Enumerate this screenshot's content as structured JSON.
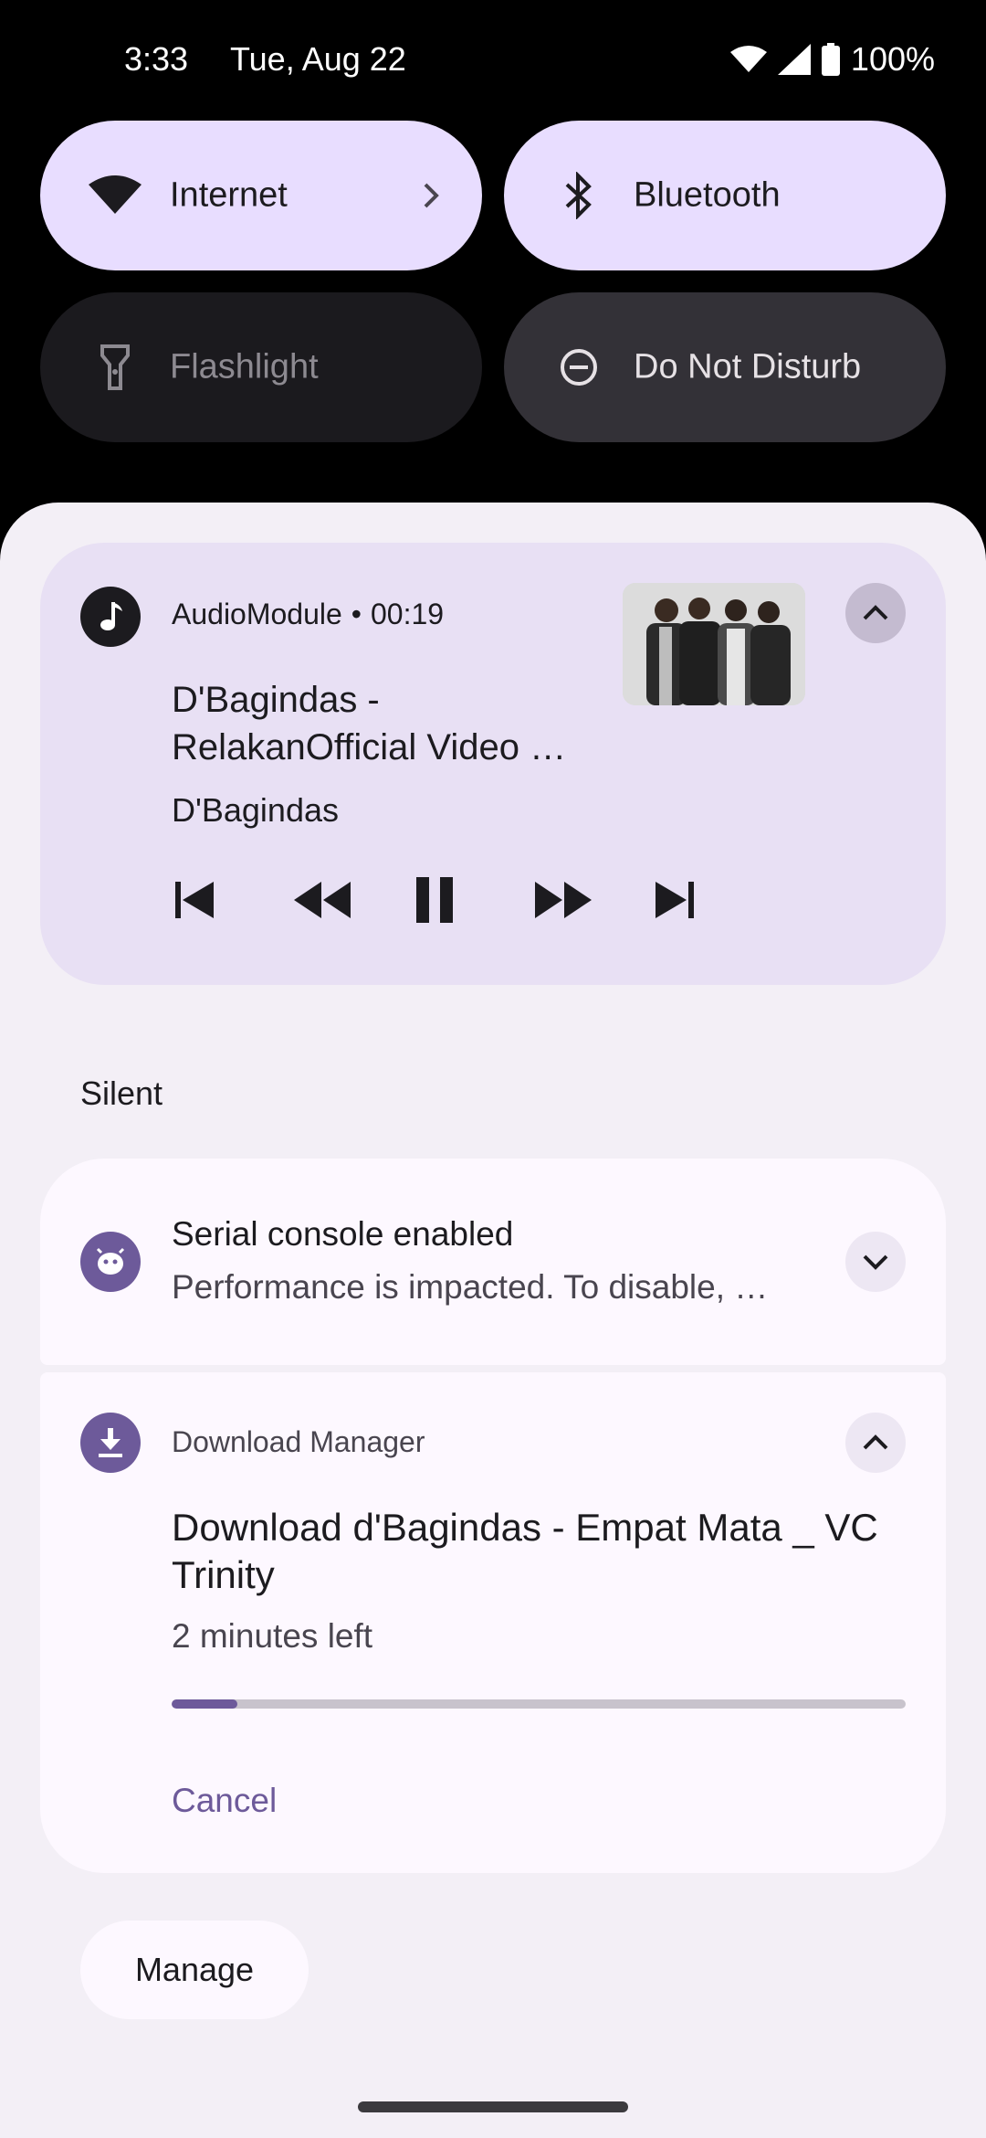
{
  "status_bar": {
    "time": "3:33",
    "date": "Tue, Aug 22",
    "battery": "100%",
    "icons": [
      "wifi-icon",
      "cell-signal-icon",
      "battery-icon"
    ]
  },
  "quick_settings": [
    {
      "label": "Internet",
      "icon": "wifi-icon",
      "state": "on",
      "has_chevron": true
    },
    {
      "label": "Bluetooth",
      "icon": "bluetooth-icon",
      "state": "on"
    },
    {
      "label": "Flashlight",
      "icon": "flashlight-icon",
      "state": "off"
    },
    {
      "label": "Do Not Disturb",
      "icon": "do-not-disturb-icon",
      "state": "off"
    }
  ],
  "media": {
    "app_name": "AudioModule",
    "separator": "•",
    "elapsed": "00:19",
    "title": "D'Bagindas - RelakanOfficial Video …",
    "artist": "D'Bagindas",
    "controls": [
      "skip-previous-icon",
      "rewind-icon",
      "pause-icon",
      "fast-forward-icon",
      "skip-next-icon"
    ]
  },
  "section": {
    "silent_label": "Silent"
  },
  "notifications": {
    "serial": {
      "title": "Serial console enabled",
      "text": "Performance is impacted. To disable, …"
    },
    "download": {
      "app_name": "Download Manager",
      "title": "Download d'Bagindas - Empat Mata _ VC Trinity",
      "subtext": "2 minutes left",
      "progress": 0.09,
      "action": "Cancel"
    }
  },
  "manage_label": "Manage",
  "colors": {
    "accent": "#6d5a9a",
    "tile_on": "#e8ddff",
    "media_bg": "#e8e0f4",
    "shade_bg": "#f3eff6"
  }
}
